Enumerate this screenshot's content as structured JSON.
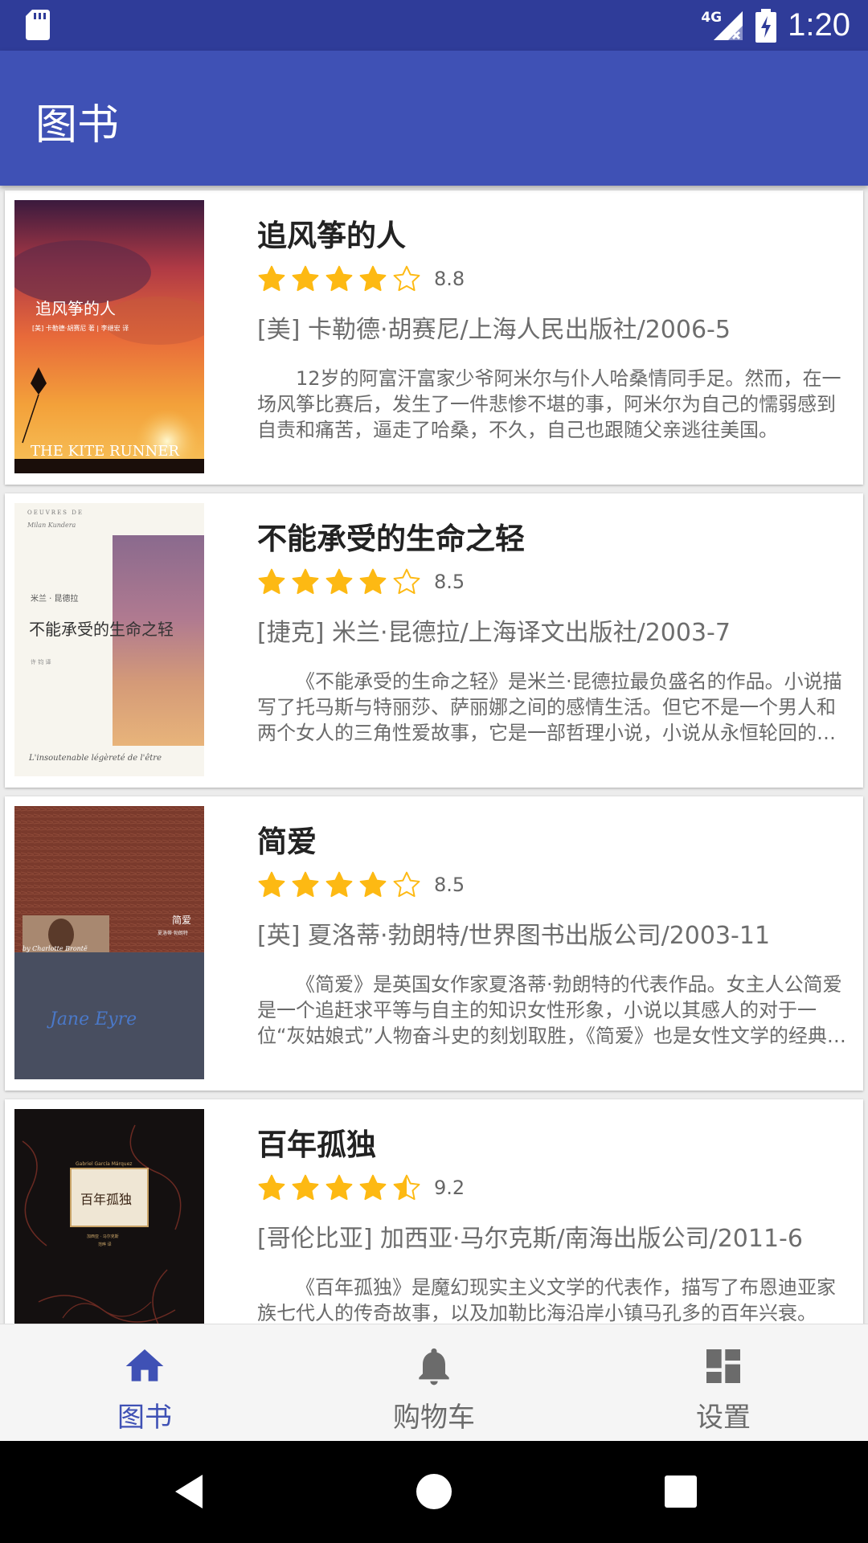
{
  "status_bar": {
    "time": "1:20",
    "network": "4G"
  },
  "app_bar": {
    "title": "图书"
  },
  "books": [
    {
      "title": "追风筝的人",
      "rating": 8.8,
      "rating_text": "8.8",
      "meta": "[美] 卡勒德·胡赛尼/上海人民出版社/2006-5",
      "description": "12岁的阿富汗富家少爷阿米尔与仆人哈桑情同手足。然而，在一场风筝比赛后，发生了一件悲惨不堪的事，阿米尔为自己的懦弱感到自责和痛苦，逼走了哈桑，不久，自己也跟随父亲逃往美国。",
      "cover": {
        "title": "追风筝的人",
        "author": "[美] 卡勒德·胡赛尼 著 | 李继宏 译",
        "subtitle": "THE KITE RUNNER"
      }
    },
    {
      "title": "不能承受的生命之轻",
      "rating": 8.5,
      "rating_text": "8.5",
      "meta": "[捷克] 米兰·昆德拉/上海译文出版社/2003-7",
      "description": "《不能承受的生命之轻》是米兰·昆德拉最负盛名的作品。小说描写了托马斯与特丽莎、萨丽娜之间的感情生活。但它不是一个男人和两个女人的三角性爱故事，它是一部哲理小说，小说从永恒轮回的讨论开始。",
      "cover": {
        "top": "OEUVRES DE",
        "author_en": "Milan Kundera",
        "author_cn": "米兰 · 昆德拉",
        "title": "不能承受的生命之轻",
        "translator": "许 钧 译",
        "subtitle": "L'insoutenable légèreté de l'être"
      }
    },
    {
      "title": "简爱",
      "rating": 8.5,
      "rating_text": "8.5",
      "meta": "[英] 夏洛蒂·勃朗特/世界图书出版公司/2003-11",
      "description": "《简爱》是英国女作家夏洛蒂·勃朗特的代表作品。女主人公简爱是一个追赶求平等与自主的知识女性形象，小说以其感人的对于一位“灰姑娘式”人物奋斗史的刻划取胜，《简爱》也是女性文学的经典之作。",
      "cover": {
        "title": "简爱",
        "author_cn": "夏洛蒂·勃朗特",
        "author_en": "by Charlotte Brontë",
        "subtitle": "Jane Eyre"
      }
    },
    {
      "title": "百年孤独",
      "rating": 9.2,
      "rating_text": "9.2",
      "meta": "[哥伦比亚] 加西亚·马尔克斯/南海出版公司/2011-6",
      "description": "《百年孤独》是魔幻现实主义文学的代表作，描写了布恩迪亚家族七代人的传奇故事，以及加勒比海沿岸小镇马孔多的百年兴衰。",
      "cover": {
        "author_en": "Gabriel García Márquez",
        "title": "百年孤独",
        "author_cn": "加西亚 · 马尔克斯",
        "translator": "范晔 译"
      }
    }
  ],
  "bottom_nav": [
    {
      "label": "图书",
      "icon": "home-icon",
      "active": true
    },
    {
      "label": "购物车",
      "icon": "bell-icon",
      "active": false
    },
    {
      "label": "设置",
      "icon": "dashboard-icon",
      "active": false
    }
  ],
  "colors": {
    "primary": "#3f51b5",
    "primary_dark": "#2f3c99",
    "star": "#fdb913"
  }
}
